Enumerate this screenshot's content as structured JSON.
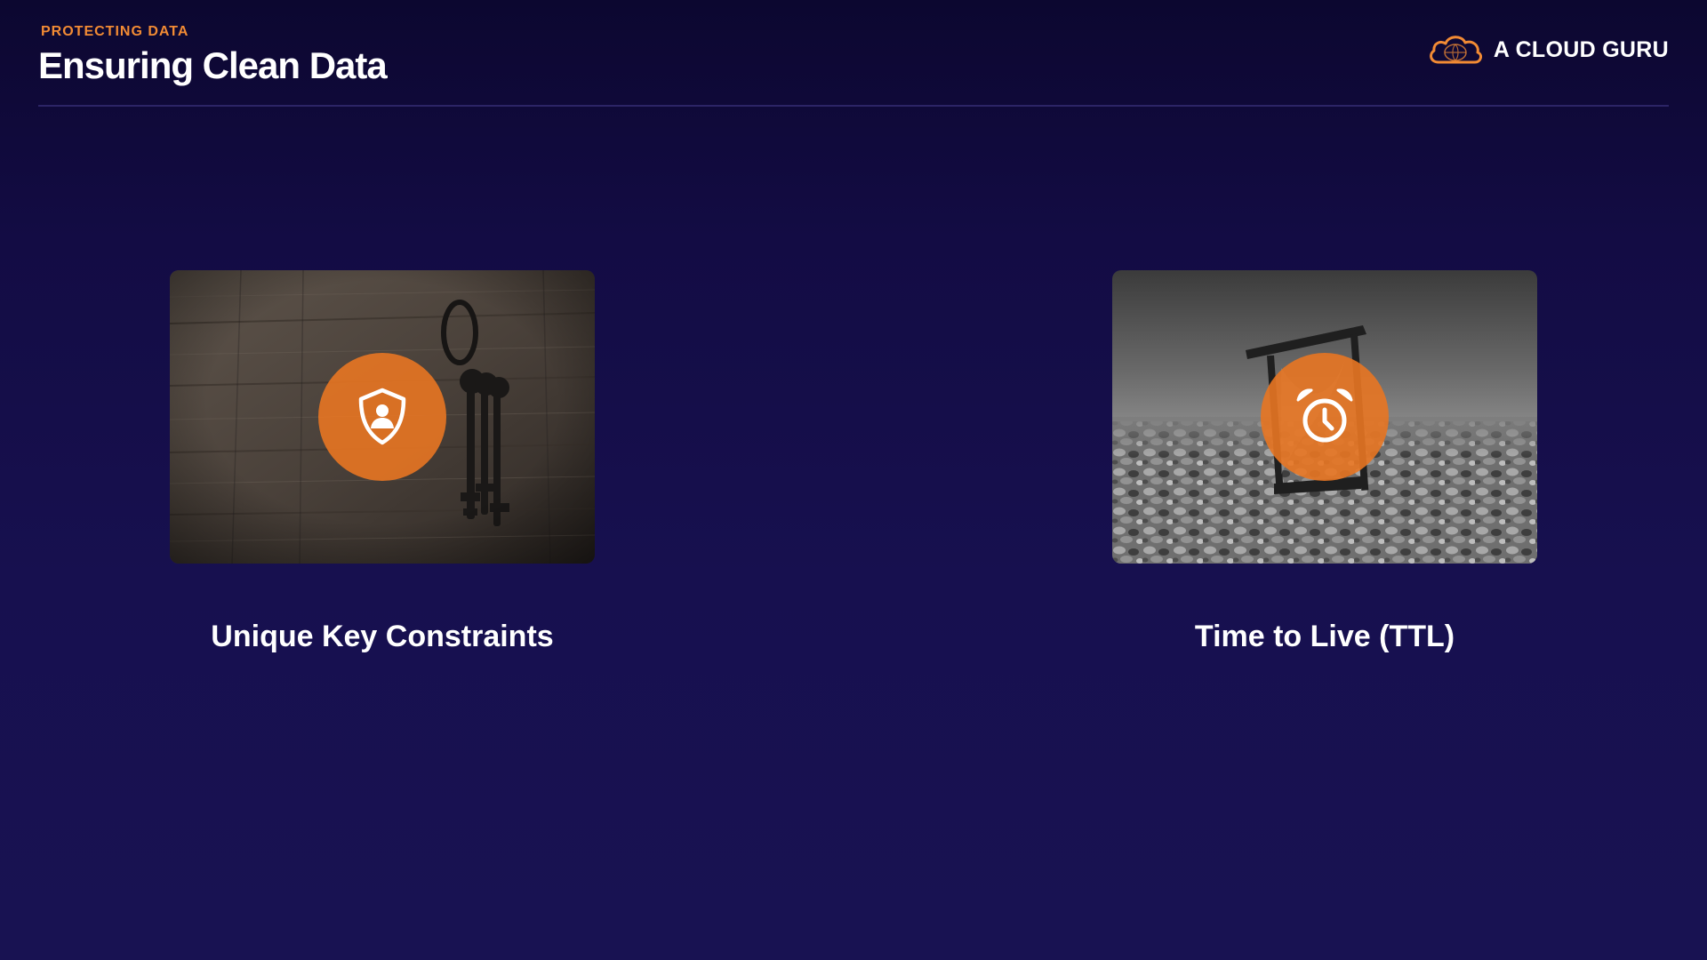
{
  "header": {
    "eyebrow": "PROTECTING DATA",
    "title": "Ensuring Clean Data"
  },
  "brand": {
    "name": "A CLOUD GURU",
    "logo_icon": "cloud-logo-icon",
    "logo_color": "#f28b34"
  },
  "colors": {
    "accent": "#f28b34",
    "background": "#17104f",
    "text": "#ffffff"
  },
  "cards": [
    {
      "photo": "wooden-wall-with-keys-photo",
      "icon": "shield-user-icon",
      "label": "Unique Key Constraints"
    },
    {
      "photo": "hourglass-on-pebbles-photo",
      "icon": "alarm-clock-icon",
      "label": "Time to Live (TTL)"
    }
  ]
}
